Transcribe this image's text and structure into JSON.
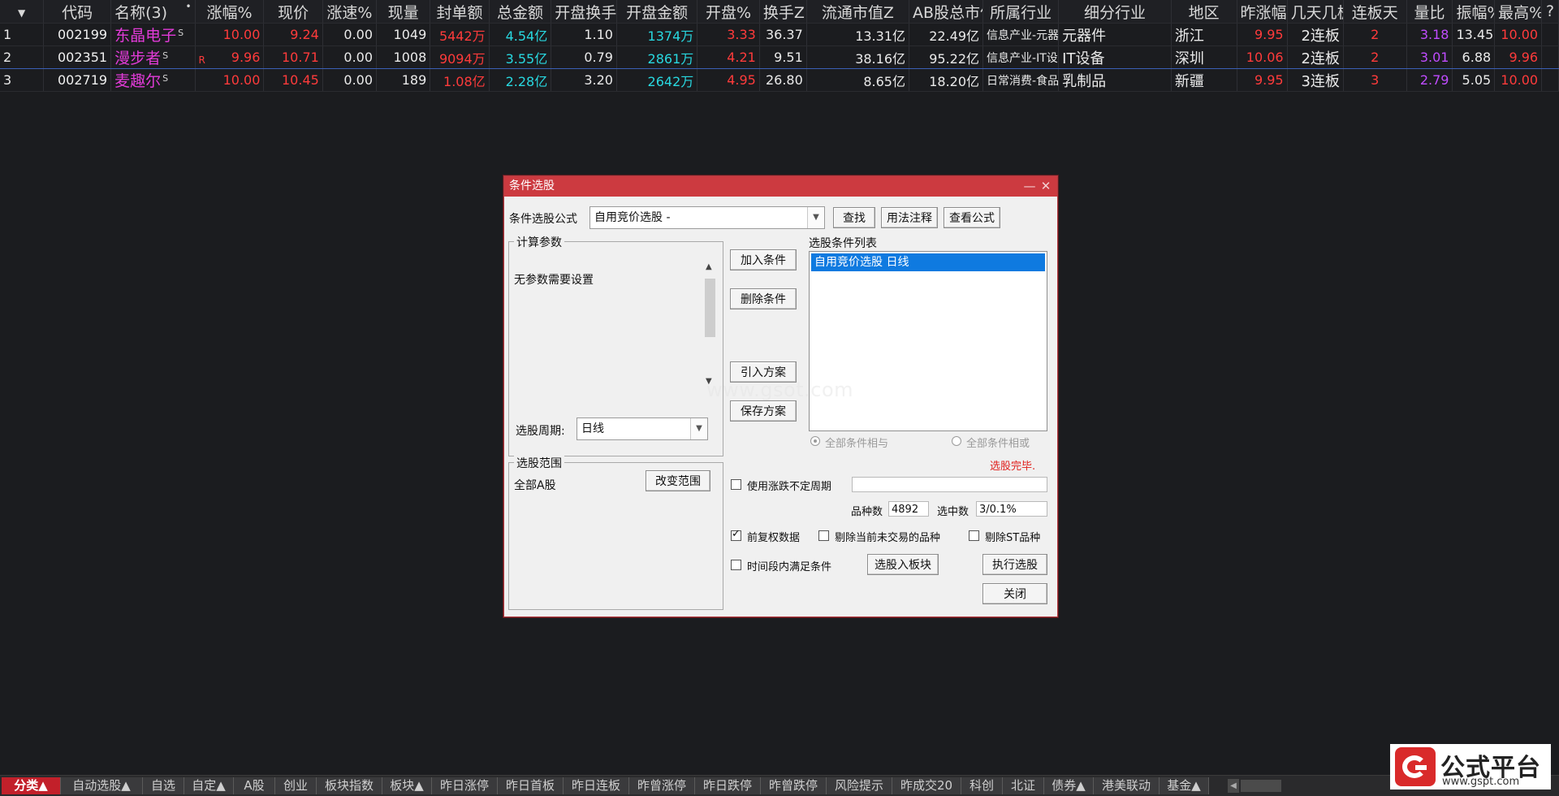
{
  "table": {
    "corner_arrow": "▼",
    "sort_dot": "•",
    "name_header": "名称(3)",
    "headers": [
      "代码",
      "涨幅%",
      "现价",
      "涨速%",
      "现量",
      "封单额",
      "总金额",
      "开盘换手Z",
      "开盘金额",
      "开盘%",
      "换手Z",
      "流通市值Z",
      "AB股总市值",
      "所属行业",
      "细分行业",
      "地区",
      "昨涨幅%",
      "几天几板",
      "连板天",
      "量比",
      "振幅%",
      "最高%",
      "?"
    ],
    "rows": [
      {
        "idx": "1",
        "code": "002199",
        "name": "东晶电子",
        "tag": "S",
        "mark": "",
        "chg": "10.00",
        "price": "9.24",
        "speed": "0.00",
        "vol": "1049",
        "seal": "5442万",
        "amount": "4.54亿",
        "open_turn": "1.10",
        "open_amt": "1374万",
        "open_pct": "3.33",
        "turn": "36.37",
        "float_mv": "13.31亿",
        "total_mv": "22.49亿",
        "industry": "信息产业-元器件",
        "sub_industry": "元器件",
        "region": "浙江",
        "prev_chg": "9.95",
        "boards": "2连板",
        "streak": "2",
        "vol_ratio": "3.18",
        "amp": "13.45",
        "high": "10.00"
      },
      {
        "idx": "2",
        "code": "002351",
        "name": "漫步者",
        "tag": "S",
        "mark": "R",
        "chg": "9.96",
        "price": "10.71",
        "speed": "0.00",
        "vol": "1008",
        "seal": "9094万",
        "amount": "3.55亿",
        "open_turn": "0.79",
        "open_amt": "2861万",
        "open_pct": "4.21",
        "turn": "9.51",
        "float_mv": "38.16亿",
        "total_mv": "95.22亿",
        "industry": "信息产业-IT设备",
        "sub_industry": "IT设备",
        "region": "深圳",
        "prev_chg": "10.06",
        "boards": "2连板",
        "streak": "2",
        "vol_ratio": "3.01",
        "amp": "6.88",
        "high": "9.96"
      },
      {
        "idx": "3",
        "code": "002719",
        "name": "麦趣尔",
        "tag": "S",
        "mark": "",
        "chg": "10.00",
        "price": "10.45",
        "speed": "0.00",
        "vol": "189",
        "seal": "1.08亿",
        "amount": "2.28亿",
        "open_turn": "3.20",
        "open_amt": "2642万",
        "open_pct": "4.95",
        "turn": "26.80",
        "float_mv": "8.65亿",
        "total_mv": "18.20亿",
        "industry": "日常消费-食品饮料",
        "sub_industry": "乳制品",
        "region": "新疆",
        "prev_chg": "9.95",
        "boards": "3连板",
        "streak": "3",
        "vol_ratio": "2.79",
        "amp": "5.05",
        "high": "10.00"
      }
    ]
  },
  "dialog": {
    "title": "条件选股",
    "minimize": "—",
    "close": "✕",
    "formula_label": "条件选股公式",
    "formula_value": "自用竞价选股 -",
    "btn_find": "查找",
    "btn_usage": "用法注释",
    "btn_view": "查看公式",
    "params_group": "计算参数",
    "params_text": "无参数需要设置",
    "period_label": "选股周期:",
    "period_value": "日线",
    "btn_add": "加入条件",
    "btn_delete": "删除条件",
    "btn_import": "引入方案",
    "btn_save": "保存方案",
    "list_title": "选股条件列表",
    "list_items": [
      "自用竞价选股  日线"
    ],
    "radio_and": "全部条件相与",
    "radio_or": "全部条件相或",
    "status": "选股完毕.",
    "scope_group": "选股范围",
    "scope_value": "全部A股",
    "btn_change_scope": "改变范围",
    "chk_period_label": "使用涨跌不定周期",
    "count_label": "品种数",
    "count_value": "4892",
    "selected_label": "选中数",
    "selected_value": "3/0.1%",
    "chk_adjust_label": "前复权数据",
    "chk_adjust": true,
    "chk_untraded_label": "剔除当前未交易的品种",
    "chk_st_label": "剔除ST品种",
    "chk_timeframe_label": "时间段内满足条件",
    "btn_to_block": "选股入板块",
    "btn_execute": "执行选股",
    "btn_close": "关闭"
  },
  "watermark": "www.gsot.com",
  "tabs": [
    "分类▲",
    "自动选股▲",
    "自选",
    "自定▲",
    "A股",
    "创业",
    "板块指数",
    "板块▲",
    "昨日涨停",
    "昨日首板",
    "昨日连板",
    "昨曾涨停",
    "昨日跌停",
    "昨曾跌停",
    "风险提示",
    "昨成交20",
    "科创",
    "北证",
    "债券▲",
    "港美联动",
    "基金▲"
  ],
  "logo": {
    "name": "公式平台",
    "url": "www.gspt.com"
  },
  "colors": {
    "up": "#ff3b3b",
    "cyan": "#28d8e0",
    "stock_name": "#e23bd8",
    "dialog_title": "#cc3a40",
    "list_selected": "#0f7ae0"
  }
}
